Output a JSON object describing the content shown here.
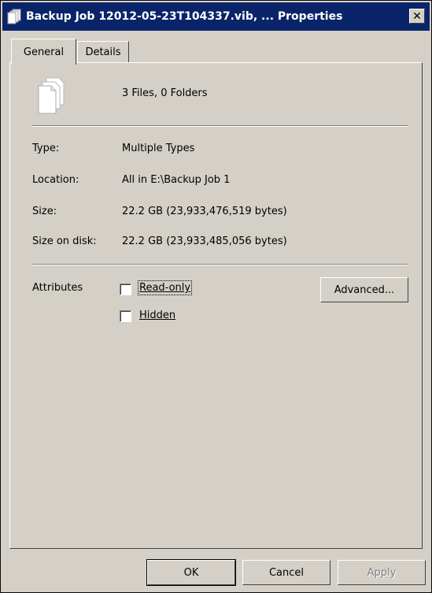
{
  "window": {
    "title": "Backup Job 12012-05-23T104337.vib, ... Properties",
    "close_label": "✕"
  },
  "tabs": [
    {
      "label": "General",
      "active": true
    },
    {
      "label": "Details",
      "active": false
    }
  ],
  "summary": {
    "icon": "multiple-files-icon",
    "text": "3 Files, 0 Folders"
  },
  "properties": {
    "type_label": "Type:",
    "type_value": "Multiple Types",
    "location_label": "Location:",
    "location_value": "All in E:\\Backup Job 1",
    "size_label": "Size:",
    "size_value": "22.2 GB (23,933,476,519 bytes)",
    "size_on_disk_label": "Size on disk:",
    "size_on_disk_value": "22.2 GB (23,933,485,056 bytes)"
  },
  "attributes": {
    "label": "Attributes",
    "read_only_label": "Read-only",
    "read_only_checked": false,
    "hidden_label": "Hidden",
    "hidden_checked": false,
    "advanced_label": "Advanced..."
  },
  "buttons": {
    "ok": "OK",
    "cancel": "Cancel",
    "apply": "Apply"
  },
  "colors": {
    "titlebar": "#0a246a",
    "face": "#d4d0c8"
  }
}
